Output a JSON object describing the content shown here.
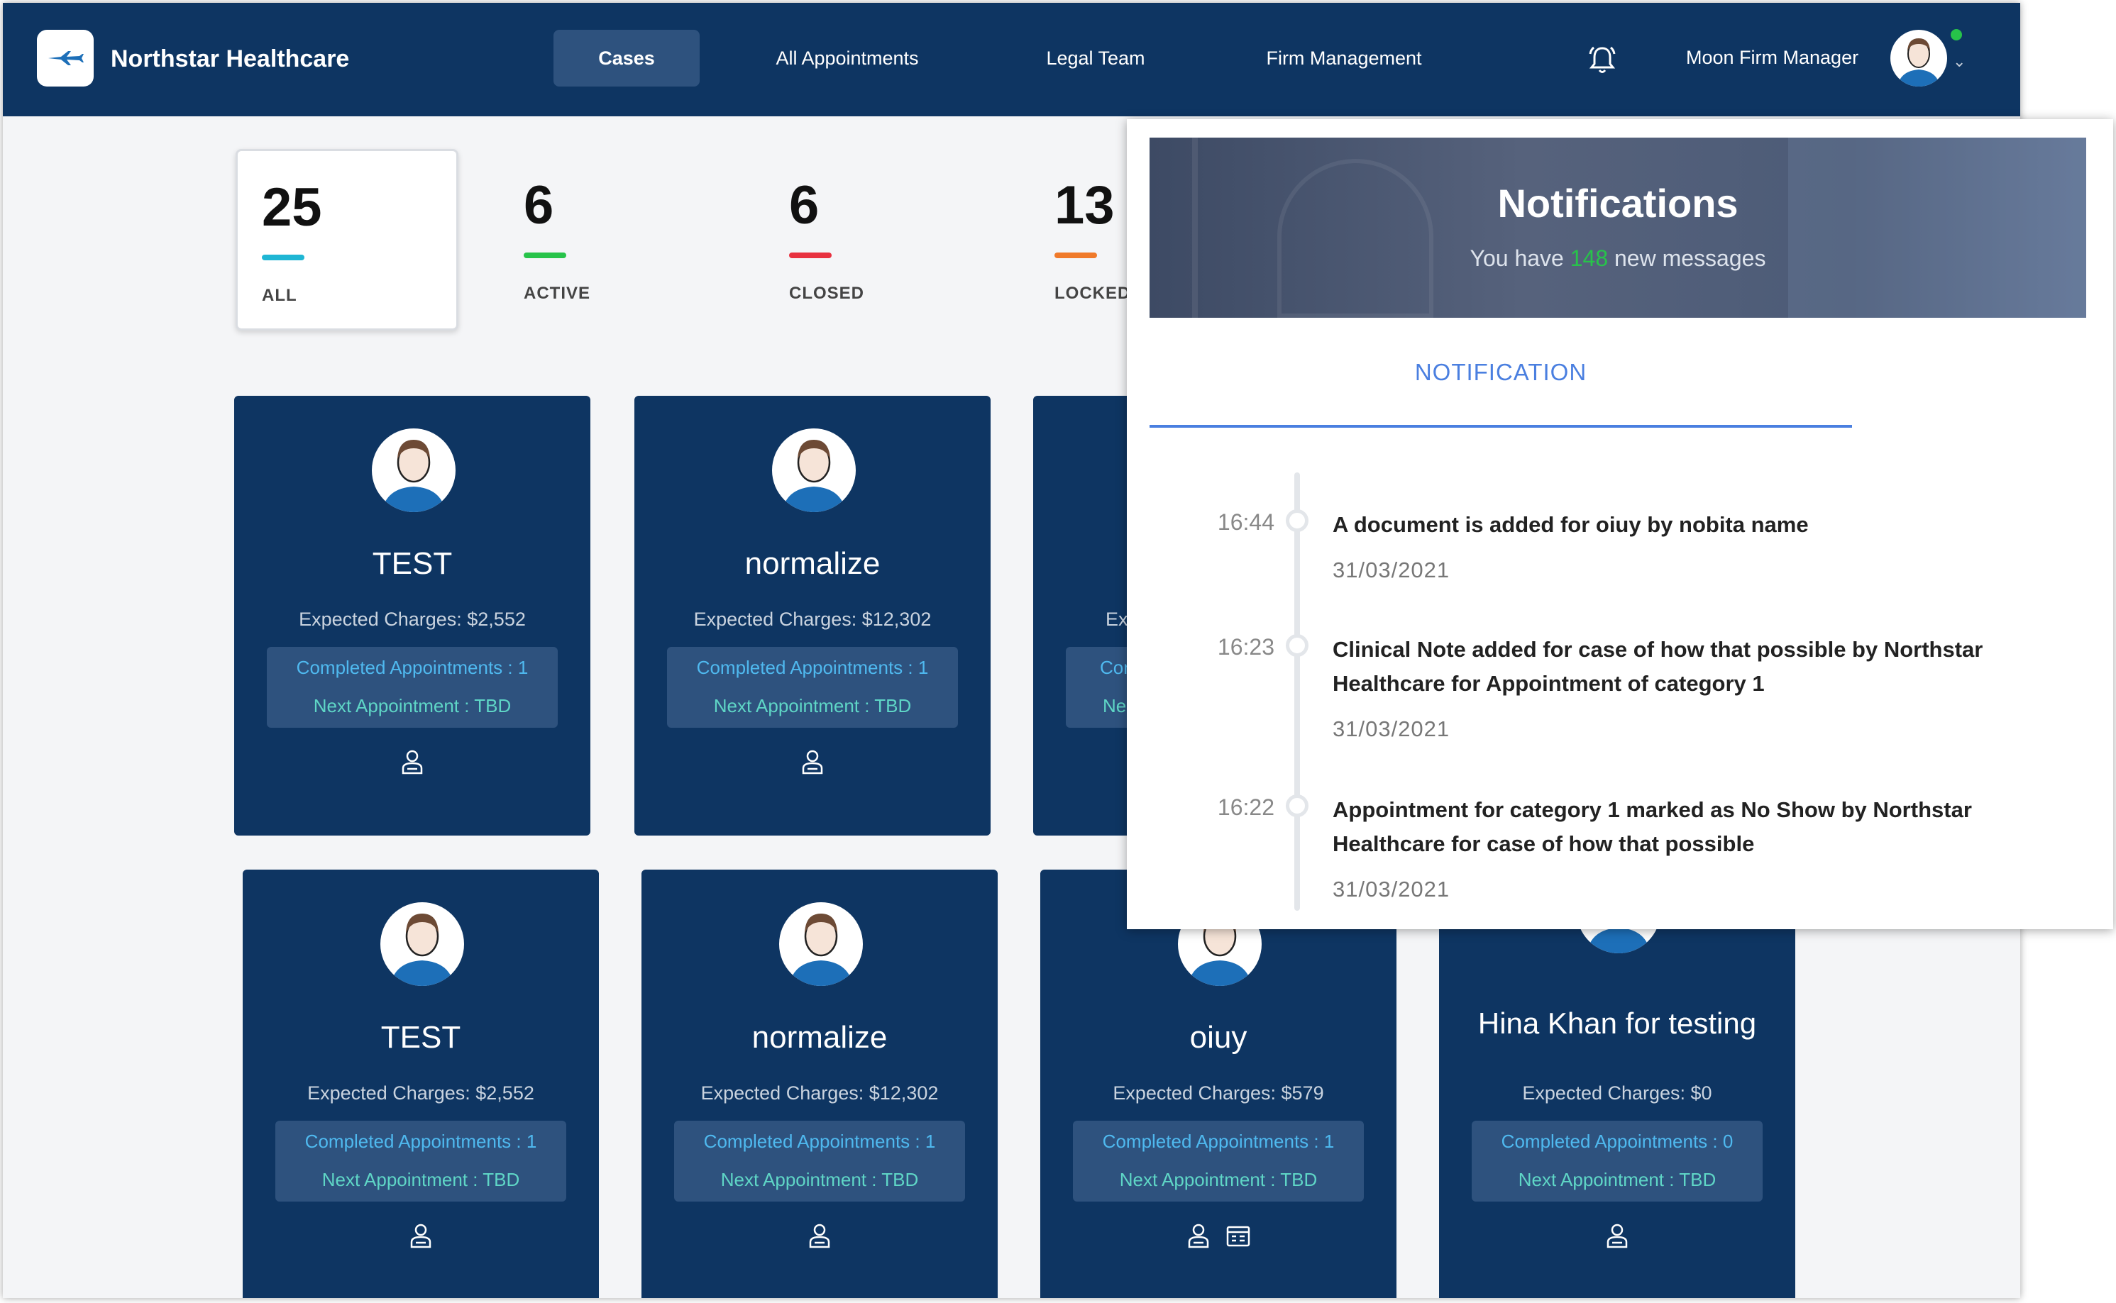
{
  "header": {
    "brand": "Northstar Healthcare",
    "nav": [
      "Cases",
      "All Appointments",
      "Legal Team",
      "Firm Management"
    ],
    "user_name": "Moon Firm Manager"
  },
  "stats": [
    {
      "value": "25",
      "label": "ALL",
      "color": "#1fb6d4"
    },
    {
      "value": "6",
      "label": "ACTIVE",
      "color": "#27c34a"
    },
    {
      "value": "6",
      "label": "CLOSED",
      "color": "#e8313f"
    },
    {
      "value": "13",
      "label": "LOCKED",
      "color": "#f07a2a"
    }
  ],
  "cards": [
    {
      "title": "TEST",
      "charges": "Expected Charges: $2,552",
      "completed": "Completed Appointments : 1",
      "next": "Next Appointment : TBD"
    },
    {
      "title": "normalize",
      "charges": "Expected Charges: $12,302",
      "completed": "Completed Appointments : 1",
      "next": "Next Appointment : TBD"
    },
    {
      "title": "",
      "charges": "Ex",
      "completed": "Com",
      "next": "Ne"
    },
    {
      "title": "TEST",
      "charges": "Expected Charges: $2,552",
      "completed": "Completed Appointments : 1",
      "next": "Next Appointment : TBD"
    },
    {
      "title": "normalize",
      "charges": "Expected Charges: $12,302",
      "completed": "Completed Appointments : 1",
      "next": "Next Appointment : TBD"
    },
    {
      "title": "oiuy",
      "charges": "Expected Charges: $579",
      "completed": "Completed Appointments : 1",
      "next": "Next Appointment : TBD"
    },
    {
      "title": "Hina Khan for testing",
      "charges": "Expected Charges: $0",
      "completed": "Completed Appointments : 0",
      "next": "Next Appointment : TBD"
    }
  ],
  "notifications": {
    "title": "Notifications",
    "sub_prefix": "You have",
    "count": "148",
    "sub_suffix": "new messages",
    "tab": "NOTIFICATION",
    "items": [
      {
        "time": "16:44",
        "text": "A document is added for oiuy by nobita name",
        "date": "31/03/2021"
      },
      {
        "time": "16:23",
        "text": "Clinical Note added for case of how that possible by Northstar Healthcare for Appointment of category 1",
        "date": "31/03/2021"
      },
      {
        "time": "16:22",
        "text": "Appointment for category 1 marked as No Show by Northstar Healthcare for case of how that possible",
        "date": "31/03/2021"
      }
    ]
  },
  "icons": {
    "bell": "bell-icon",
    "case_manager": "doctor-icon",
    "calendar": "calendar-icon"
  }
}
